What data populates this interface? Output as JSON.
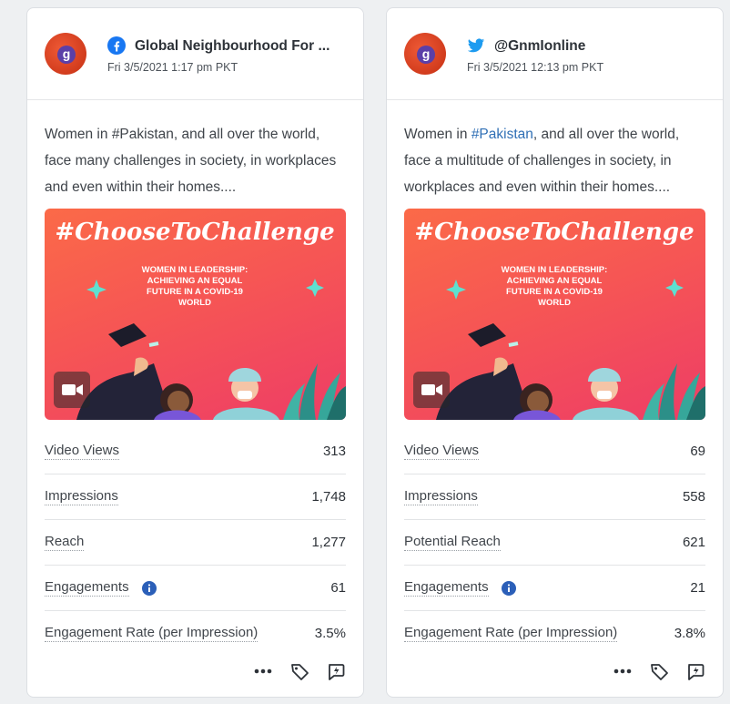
{
  "colors": {
    "accent_link": "#2f6fb5",
    "facebook": "#1877f2",
    "twitter": "#1d9bf0",
    "info": "#2b5fb8"
  },
  "posts": [
    {
      "network_icon": "facebook-icon",
      "author": "Global Neighbourhood For ...",
      "avatar_letter": "g",
      "date": "Fri 3/5/2021 1:17 pm PKT",
      "text_before": "Women in ",
      "hashtag": "#Pakistan",
      "text_after": ", and all over the world, face many challenges in society, in workplaces and even within their homes....",
      "media": {
        "headline": "#ChooseToChallenge",
        "caption_lines": [
          "WOMEN IN LEADERSHIP:",
          "ACHIEVING AN EQUAL",
          "FUTURE IN A COVID-19",
          "WORLD"
        ],
        "video_icon": "video-camera-icon"
      },
      "metrics": [
        {
          "label": "Video Views",
          "value": "313"
        },
        {
          "label": "Impressions",
          "value": "1,748"
        },
        {
          "label": "Reach",
          "value": "1,277"
        },
        {
          "label": "Engagements",
          "value": "61",
          "info": true
        },
        {
          "label": "Engagement Rate (per Impression)",
          "value": "3.5%"
        }
      ],
      "actions": [
        "more-icon",
        "tag-icon",
        "reply-icon"
      ]
    },
    {
      "network_icon": "twitter-icon",
      "author": "@GnmIonline",
      "avatar_letter": "g",
      "date": "Fri 3/5/2021 12:13 pm PKT",
      "text_before": "Women in ",
      "hashtag": "#Pakistan",
      "text_after": ", and all over the world, face a multitude of challenges in society, in workplaces and even within their homes....",
      "media": {
        "headline": "#ChooseToChallenge",
        "caption_lines": [
          "WOMEN IN LEADERSHIP:",
          "ACHIEVING AN EQUAL",
          "FUTURE IN A COVID-19",
          "WORLD"
        ],
        "video_icon": "video-camera-icon"
      },
      "metrics": [
        {
          "label": "Video Views",
          "value": "69"
        },
        {
          "label": "Impressions",
          "value": "558"
        },
        {
          "label": "Potential Reach",
          "value": "621"
        },
        {
          "label": "Engagements",
          "value": "21",
          "info": true
        },
        {
          "label": "Engagement Rate (per Impression)",
          "value": "3.8%"
        }
      ],
      "actions": [
        "more-icon",
        "tag-icon",
        "reply-icon"
      ]
    }
  ]
}
